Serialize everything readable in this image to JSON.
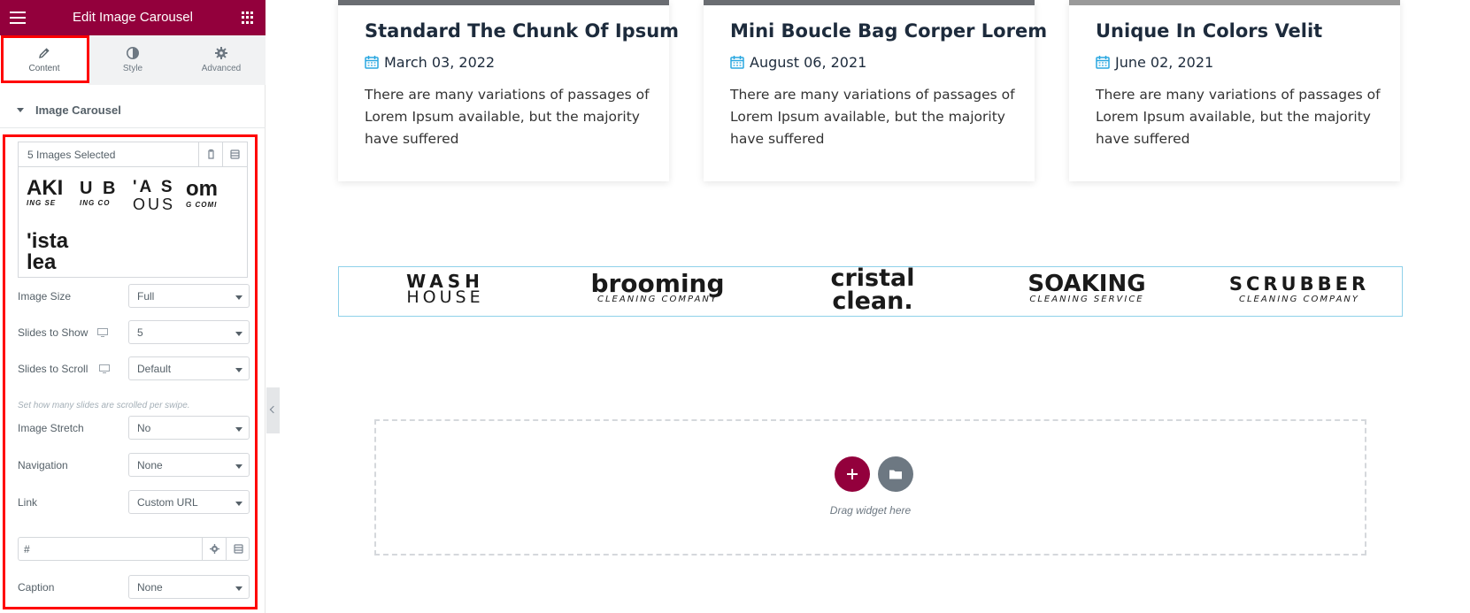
{
  "panel": {
    "title": "Edit Image Carousel",
    "tabs": [
      {
        "label": "Content",
        "icon": "pencil-icon"
      },
      {
        "label": "Style",
        "icon": "half-circle-icon"
      },
      {
        "label": "Advanced",
        "icon": "gear-icon"
      }
    ],
    "section_title": "Image Carousel",
    "gallery": {
      "count_label": "5 Images Selected",
      "thumbs": [
        "AKI",
        "U B",
        "'A S",
        "om",
        "'ista lea"
      ]
    },
    "controls": {
      "image_size": {
        "label": "Image Size",
        "value": "Full"
      },
      "slides_to_show": {
        "label": "Slides to Show",
        "value": "5"
      },
      "slides_to_scroll": {
        "label": "Slides to Scroll",
        "value": "Default",
        "hint": "Set how many slides are scrolled per swipe."
      },
      "image_stretch": {
        "label": "Image Stretch",
        "value": "No"
      },
      "navigation": {
        "label": "Navigation",
        "value": "None"
      },
      "link": {
        "label": "Link",
        "value": "Custom URL",
        "url_value": "#"
      },
      "caption": {
        "label": "Caption",
        "value": "None"
      }
    },
    "accent_color": "#93003c",
    "highlight_color": "#ff0000"
  },
  "posts": [
    {
      "title": "Standard The Chunk Of Ipsum",
      "date": "March 03, 2022",
      "excerpt": "There are many variations of passages of Lorem Ipsum available, but the majority have suffered"
    },
    {
      "title": "Mini Boucle Bag Corper Lorem",
      "date": "August 06, 2021",
      "excerpt": "There are many variations of passages of Lorem Ipsum available, but the majority have suffered"
    },
    {
      "title": "Unique In Colors Velit",
      "date": "June 02, 2021",
      "excerpt": "There are many variations of passages of Lorem Ipsum available, but the majority have suffered"
    }
  ],
  "logos": [
    {
      "line1": "WASH",
      "line2": "HOUSE"
    },
    {
      "line1": "brooming",
      "line2": "CLEANING COMPANY"
    },
    {
      "line1": "cristal",
      "line2": "clean."
    },
    {
      "line1": "SOAKING",
      "line2": "CLEANING SERVICE"
    },
    {
      "line1": "SCRUBBER",
      "line2": "CLEANING COMPANY"
    }
  ],
  "dropzone": {
    "text": "Drag widget here"
  }
}
